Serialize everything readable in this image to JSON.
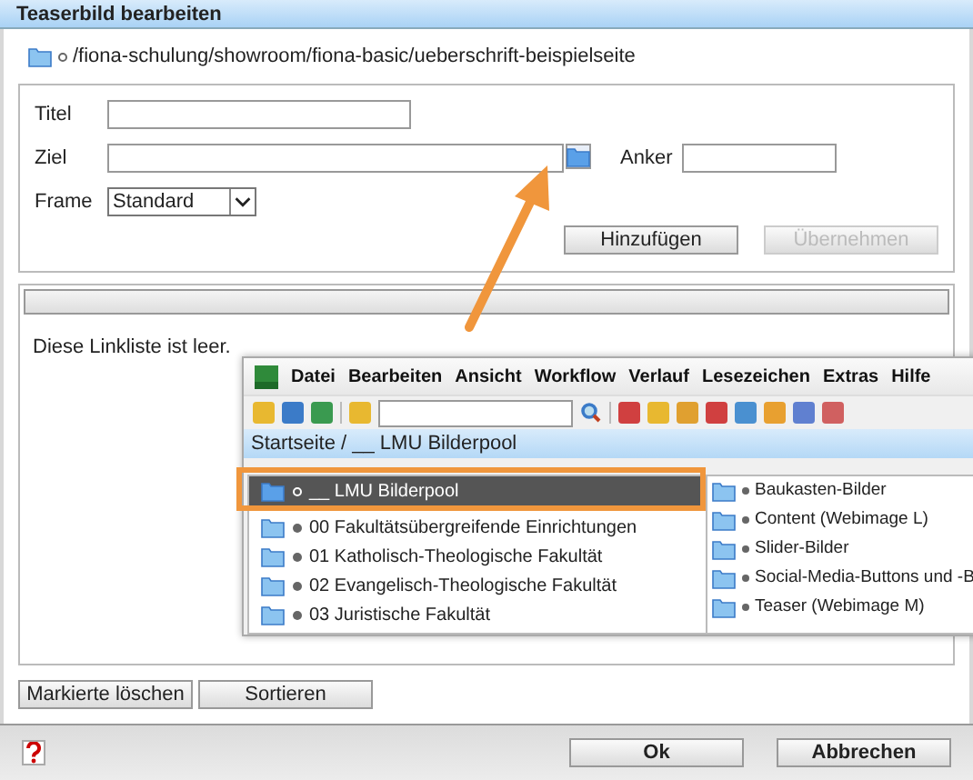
{
  "window": {
    "title": "Teaserbild bearbeiten"
  },
  "path": "/fiona-schulung/showroom/fiona-basic/ueberschrift-beispielseite",
  "form": {
    "fields": [
      {
        "label": "Titel"
      },
      {
        "label": "Ziel"
      }
    ],
    "anchor": {
      "label": "Anker"
    },
    "frame": {
      "label": "Frame",
      "value": "Standard"
    },
    "buttons": [
      {
        "label": "Hinzufügen",
        "disabled": false
      },
      {
        "label": "Übernehmen",
        "disabled": true
      }
    ]
  },
  "linklist": {
    "empty_text": "Diese Linkliste ist leer.",
    "buttons": [
      "Markierte löschen",
      "Sortieren"
    ]
  },
  "footer": {
    "buttons": [
      "Ok",
      "Abbrechen"
    ]
  },
  "overlay": {
    "menu": [
      "Datei",
      "Bearbeiten",
      "Ansicht",
      "Workflow",
      "Verlauf",
      "Lesezeichen",
      "Extras",
      "Hilfe"
    ],
    "breadcrumb": "Startseite / __ LMU Bilderpool",
    "tree": [
      {
        "label": "__ LMU Bilderpool",
        "selected": true
      },
      {
        "label": "00 Fakultätsübergreifende Einrichtungen",
        "selected": false
      },
      {
        "label": "01 Katholisch-Theologische Fakultät",
        "selected": false
      },
      {
        "label": "02 Evangelisch-Theologische Fakultät",
        "selected": false
      },
      {
        "label": "03 Juristische Fakultät",
        "selected": false
      }
    ],
    "folders": [
      "Baukasten-Bilder",
      "Content (Webimage L)",
      "Slider-Bilder",
      "Social-Media-Buttons und -B",
      "Teaser (Webimage M)"
    ]
  }
}
